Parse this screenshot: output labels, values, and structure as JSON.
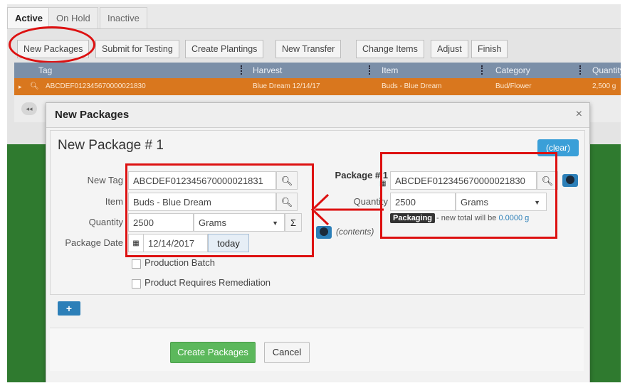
{
  "tabs": [
    "Active",
    "On Hold",
    "Inactive"
  ],
  "toolbar": [
    "New Packages",
    "Submit for Testing",
    "Create Plantings",
    "New Transfer",
    "Change Items",
    "Adjust",
    "Finish"
  ],
  "grid": {
    "headers": [
      "Tag",
      "Harvest",
      "Item",
      "Category",
      "Quantity"
    ],
    "row": [
      "ABCDEF012345670000021830",
      "Blue Dream 12/14/17",
      "Buds - Blue Dream",
      "Bud/Flower",
      "2,500 g"
    ]
  },
  "pager_icon": "first-page-icon",
  "modal": {
    "title": "New Packages",
    "close": "×",
    "package_title": "New Package # 1",
    "clear_label": "(clear)",
    "labels": {
      "new_tag": "New Tag",
      "item": "Item",
      "quantity": "Quantity",
      "package_date": "Package Date",
      "package_num": "Package # 1",
      "quantity_right": "Quantity"
    },
    "new_tag_value": "ABCDEF012345670000021831",
    "item_value": "Buds - Blue Dream",
    "quantity_value": "2500",
    "unit_value": "Grams",
    "sum_symbol": "Σ",
    "date_value": "12/14/2017",
    "today_label": "today",
    "contents_label": "(contents)",
    "source_tag": "ABCDEF012345670000021830",
    "source_quantity": "2500",
    "source_unit": "Grams",
    "packaging_badge": "Packaging",
    "new_total_prefix": "- new total will be",
    "new_total_value": "0.0000 g",
    "production_batch": "Production Batch",
    "remediation": "Product Requires Remediation",
    "add_label": "+",
    "create_label": "Create Packages",
    "cancel_label": "Cancel"
  },
  "colors": {
    "accent": "#2c7fb8",
    "grid_header": "#7b8fa8",
    "selected_row": "#d9771e",
    "annotation": "#dd1111",
    "create_button": "#5cb85c"
  }
}
